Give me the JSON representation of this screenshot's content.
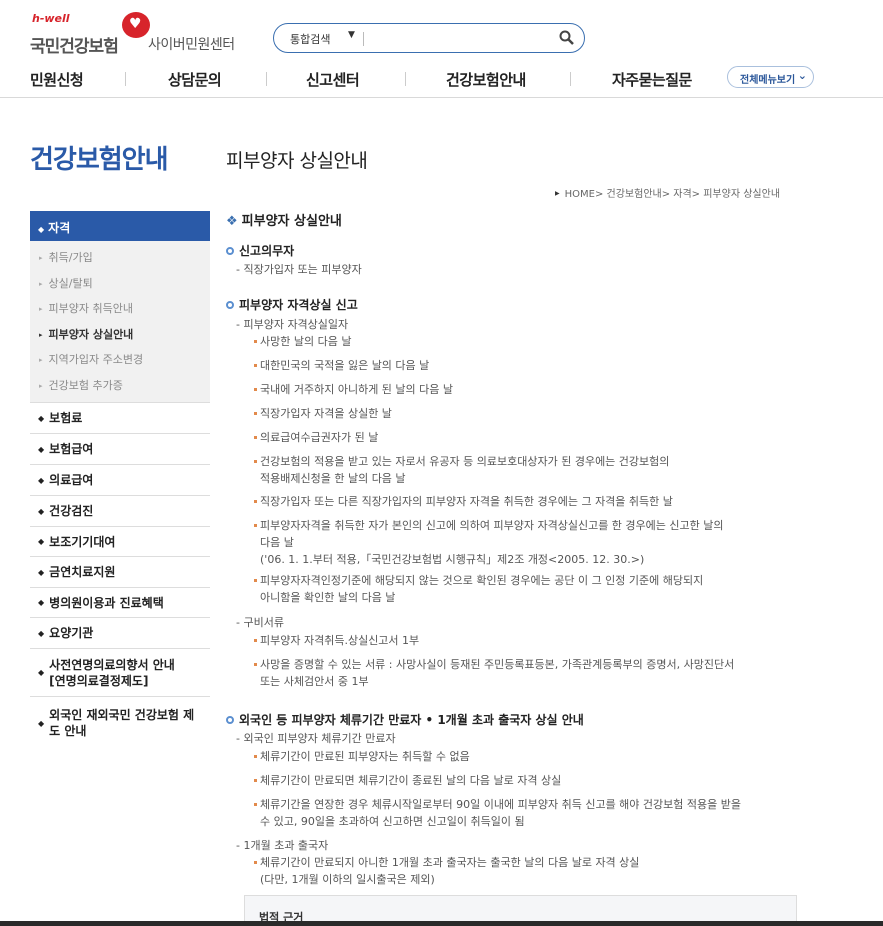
{
  "header": {
    "logo_hwell": "h-well",
    "logo_name": "국민건강보험",
    "logo_sub": "사이버민원센터",
    "search": {
      "scope": "통합검색",
      "value": "",
      "placeholder": ""
    },
    "nav": [
      "민원신청",
      "상담문의",
      "신고센터",
      "건강보험안내",
      "자주묻는질문"
    ],
    "all_menu": "전체메뉴보기"
  },
  "sidebar": {
    "title": "건강보험안내",
    "active": "자격",
    "sub_items": [
      "취득/가입",
      "상실/탈퇴",
      "피부양자 취득안내",
      "피부양자 상실안내",
      "지역가입자 주소변경",
      "건강보험 추가증"
    ],
    "current_sub": "피부양자 상실안내",
    "menu_items": [
      "보험료",
      "보험급여",
      "의료급여",
      "건강검진",
      "보조기기대여",
      "금연치료지원",
      "병의원이용과 진료혜택",
      "요양기관",
      "사전연명의료의향서 안내\n[연명의료결정제도]",
      "외국인 재외국민 건강보험 제\n도 안내"
    ]
  },
  "page": {
    "title": "피부양자 상실안내",
    "breadcrumb": "HOME> 건강보험안내> 자격> 피부양자 상실안내",
    "section_title": "피부양자 상실안내",
    "h_reporter": "신고의무자",
    "reporter_dash": "- 직장가입자 또는 피부양자",
    "h_loss": "피부양자 자격상실 신고",
    "loss_date_dash": "- 피부양자 자격상실일자",
    "loss_items": [
      "사망한 날의 다음 날",
      "대한민국의 국적을 잃은 날의 다음 날",
      "국내에 거주하지 아니하게 된 날의 다음 날",
      "직장가입자 자격을 상실한 날",
      "의료급여수급권자가 된 날",
      "건강보험의 적용을 받고 있는 자로서 유공자 등 의료보호대상자가 된 경우에는 건강보험의\n적용배제신청을 한 날의 다음 날",
      "직장가입자 또는 다른 직장가입자의 피부양자 자격을 취득한 경우에는 그 자격을 취득한 날",
      "피부양자자격을 취득한 자가 본인의 신고에 의하여 피부양자 자격상실신고를 한 경우에는 신고한 날의\n다음 날\n('06. 1. 1.부터 적용,「국민건강보험법 시행규칙」제2조 개정<2005. 12. 30.>)",
      "피부양자자격인정기준에 해당되지 않는 것으로 확인된 경우에는 공단 이 그 인정 기준에 해당되지\n아니함을 확인한 날의 다음 날"
    ],
    "docs_dash": "- 구비서류",
    "docs_items": [
      "피부양자 자격취득.상실신고서 1부",
      "사망을 증명할 수 있는 서류 : 사망사실이 등재된 주민등록표등본, 가족관계등록부의 증명서, 사망진단서\n또는 사체검안서 중 1부"
    ],
    "h_foreign": "외국인 등 피부양자 체류기간 만료자 • 1개월 초과 출국자 상실 안내",
    "foreign_dash": "- 외국인 피부양자 체류기간 만료자",
    "foreign_items": [
      "체류기간이 만료된 피부양자는 취득할 수 없음",
      "체류기간이 만료되면 체류기간이 종료된 날의 다음 날로 자격 상실",
      "체류기간을 연장한 경우 체류시작일로부터 90일 이내에 피부양자 취득 신고를 해야 건강보험 적용을 받을\n수 있고, 90일을 초과하여 신고하면 신고일이 취득일이 됨"
    ],
    "departure_dash": "- 1개월 초과 출국자",
    "departure_items": [
      "체류기간이 만료되지 아니한 1개월 초과 출국자는 출국한 날의 다음 날로 자격 상실\n(다만, 1개월 이하의 일시출국은 제외)"
    ],
    "law_box_title": "법적 근거"
  },
  "colors": {
    "brand_blue": "#2a5aa8",
    "brand_red": "#d7242b",
    "bullet_orange": "#e28a4b"
  }
}
